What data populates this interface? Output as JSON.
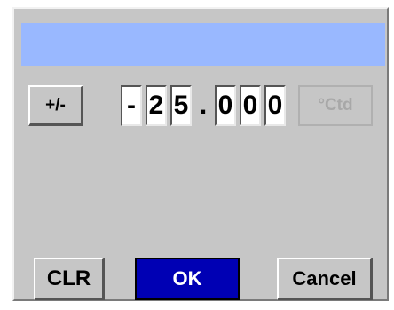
{
  "sign_button": {
    "label": "+/-"
  },
  "value": {
    "chars": [
      "-",
      "2",
      "5",
      ".",
      "0",
      "0",
      "0"
    ]
  },
  "unit_button": {
    "label": "°Ctd"
  },
  "footer": {
    "clr_label": "CLR",
    "ok_label": "OK",
    "cancel_label": "Cancel"
  },
  "colors": {
    "title_bar": "#99b8ff",
    "dialog_bg": "#c6c6c6",
    "ok_bg": "#0000b4",
    "ok_text": "#ffffff",
    "disabled_text": "#a8a8a8"
  }
}
